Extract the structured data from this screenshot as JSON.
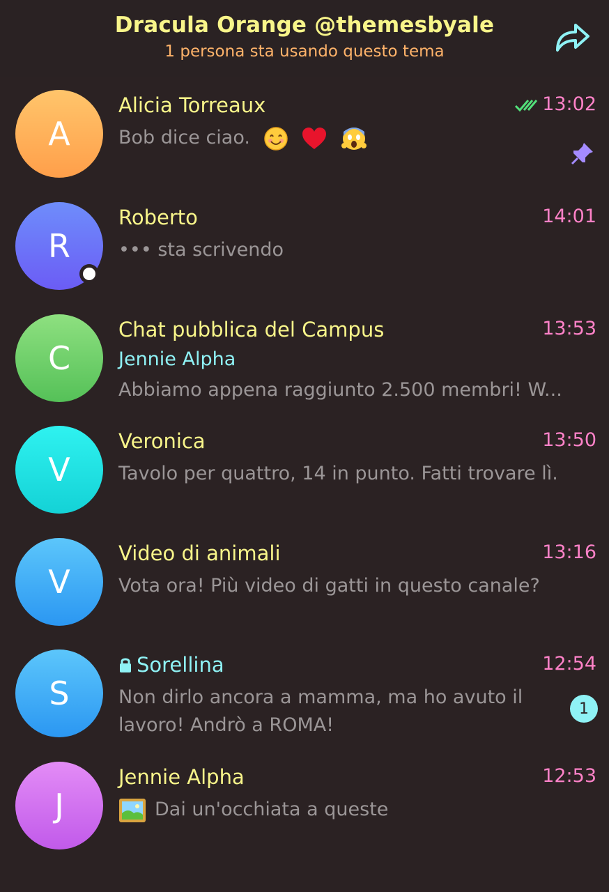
{
  "header": {
    "title": "Dracula Orange @themesbyale",
    "subtitle": "1 persona sta usando questo tema",
    "share_icon": "share-arrow-icon"
  },
  "chats": [
    {
      "initial": "A",
      "name": "Alicia Torreaux",
      "time": "13:02",
      "message": "Bob dice ciao.",
      "emojis": [
        "smiling-face",
        "red-heart",
        "screaming-face"
      ],
      "read": true,
      "pinned": true,
      "colors": [
        "#ffc56b",
        "#ff9f4a"
      ]
    },
    {
      "initial": "R",
      "name": "Roberto",
      "time": "14:01",
      "message": "••• sta scrivendo",
      "online": true,
      "colors": [
        "#6e8dfb",
        "#6b5cf5"
      ]
    },
    {
      "initial": "C",
      "name": "Chat pubblica del Campus",
      "time": "13:53",
      "sender": "Jennie Alpha",
      "message": "Abbiamo appena raggiunto 2.500 membri! W...",
      "colors": [
        "#8ee080",
        "#55c158"
      ]
    },
    {
      "initial": "V",
      "name": "Veronica",
      "time": "13:50",
      "message": "Tavolo per quattro, 14 in punto. Fatti trovare lì.",
      "colors": [
        "#2ff2f0",
        "#14d2d6"
      ]
    },
    {
      "initial": "V",
      "name": "Video di animali",
      "time": "13:16",
      "message": "Vota ora! Più video di gatti in questo canale?",
      "colors": [
        "#5cc6fb",
        "#2b97f2"
      ]
    },
    {
      "initial": "S",
      "name": "Sorellina",
      "time": "12:54",
      "message": "Non dirlo ancora a mamma, ma ho avuto il lavoro! Andrò a ROMA!",
      "secret": true,
      "unread": "1",
      "colors": [
        "#5cc6fb",
        "#2b97f2"
      ]
    },
    {
      "initial": "J",
      "name": "Jennie Alpha",
      "time": "12:53",
      "message": "Dai un'occhiata a queste",
      "has_image": true,
      "colors": [
        "#e38cf6",
        "#c15aea"
      ]
    }
  ]
}
